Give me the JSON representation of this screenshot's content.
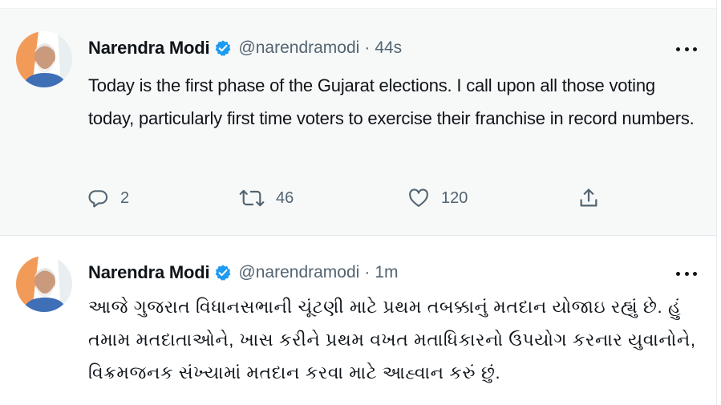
{
  "tweets": [
    {
      "author_name": "Narendra Modi",
      "handle": "@narendramodi",
      "separator": "·",
      "time": "44s",
      "text": "Today is the first phase of the Gujarat elections. I call upon all those voting today, particularly first time voters to exercise their franchise in record numbers.",
      "replies": "2",
      "retweets": "46",
      "likes": "120"
    },
    {
      "author_name": "Narendra Modi",
      "handle": "@narendramodi",
      "separator": "·",
      "time": "1m",
      "text": "આજે ગુજરાત વિધાનસભાની ચૂંટણી માટે પ્રથમ તબક્કાનું મતદાન યોજાઇ રહ્યું છે. હું તમામ મતદાતાઓને, ખાસ કરીને પ્રથમ વખત મતાધિકારનો ઉપયોગ કરનાર યુવાનોને, વિક્રમજનક સંખ્યામાં મતદાન કરવા માટે આહ્વાન કરું છું."
    }
  ],
  "colors": {
    "verified_blue": "#1d9bf0",
    "secondary_text": "#536471",
    "highlight_bg": "#f7f9f9"
  },
  "icons": {
    "verified": "verified-badge-icon",
    "more": "more-options-icon",
    "reply": "reply-icon",
    "retweet": "retweet-icon",
    "like": "like-icon",
    "share": "share-icon"
  }
}
